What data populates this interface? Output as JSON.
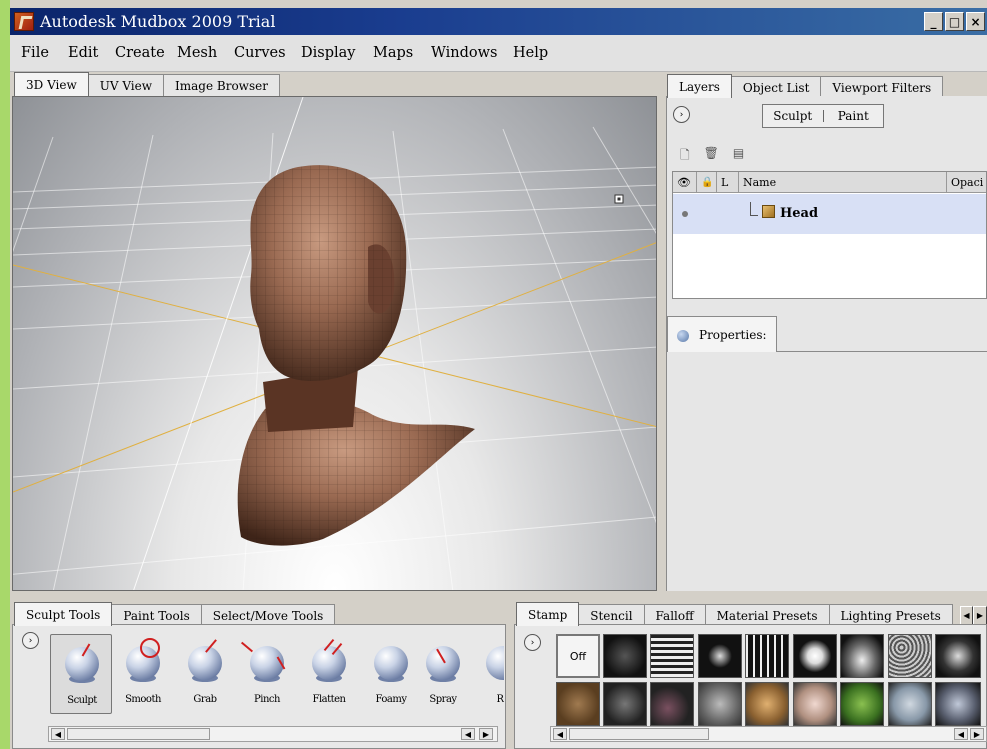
{
  "window": {
    "title": "Autodesk Mudbox 2009 Trial",
    "min": "_",
    "max": "□",
    "close": "×"
  },
  "menu": [
    "File",
    "Edit",
    "Create",
    "Mesh",
    "Curves",
    "Display",
    "Maps",
    "Windows",
    "Help"
  ],
  "view_tabs": [
    "3D View",
    "UV View",
    "Image Browser"
  ],
  "right_tabs": [
    "Layers",
    "Object List",
    "Viewport Filters"
  ],
  "layers": {
    "expand": "›",
    "mode": {
      "sculpt": "Sculpt",
      "paint": "Paint"
    },
    "icons": [
      "new-layer-icon",
      "delete-layer-icon",
      "merge-layer-icon"
    ],
    "columns": {
      "lock": "L",
      "name": "Name",
      "opacity": "Opaci"
    },
    "rows": [
      {
        "name": "Head"
      }
    ]
  },
  "properties": {
    "label": "Properties:"
  },
  "tool_tabs": [
    "Sculpt Tools",
    "Paint Tools",
    "Select/Move Tools"
  ],
  "tools": [
    "Sculpt",
    "Smooth",
    "Grab",
    "Pinch",
    "Flatten",
    "Foamy",
    "Spray",
    "R"
  ],
  "stamp_tabs": [
    "Stamp",
    "Stencil",
    "Falloff",
    "Material Presets",
    "Lighting Presets"
  ],
  "stamp": {
    "off_label": "Off"
  },
  "arrows": {
    "left": "◀",
    "right": "▶",
    "expand": "›"
  },
  "colors": {
    "titlebar": "#0a246a",
    "skin": "#9a6a52",
    "selection": "#d8e0f5",
    "grid_axis": "#e0b040"
  }
}
